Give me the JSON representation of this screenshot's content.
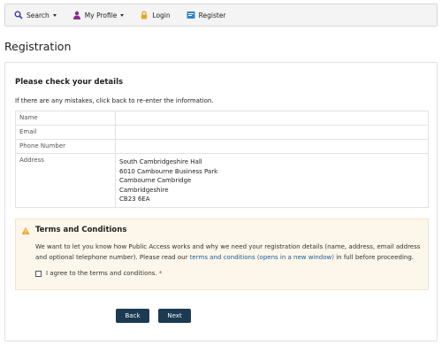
{
  "nav": {
    "search_label": "Search",
    "profile_label": "My Profile",
    "login_label": "Login",
    "register_label": "Register"
  },
  "page": {
    "title": "Registration"
  },
  "details": {
    "heading": "Please check your details",
    "intro": "If there are any mistakes, click back to re-enter the information.",
    "rows": [
      {
        "label": "Name",
        "value": ""
      },
      {
        "label": "Email",
        "value": ""
      },
      {
        "label": "Phone Number",
        "value": ""
      },
      {
        "label": "Address",
        "lines": [
          "South Cambridgeshire Hall",
          "6010 Cambourne Business Park",
          "Cambourne Cambridge",
          "Cambridgeshire",
          "CB23 6EA"
        ]
      }
    ]
  },
  "terms": {
    "title": "Terms and Conditions",
    "body_part1": "We want to let you know how Public Access works and why we need your registration details (name, address, email address and optional telephone number). Please read our ",
    "link_text": "terms and conditions (opens in a new window)",
    "body_part2": " in full before proceeding.",
    "agree_label": "I agree to the terms and conditions.",
    "required_marker": "*"
  },
  "buttons": {
    "back": "Back",
    "next": "Next"
  },
  "colors": {
    "button_bg": "#1c3a52",
    "terms_bg": "#fcf7ea",
    "link": "#1d5a9c",
    "warning": "#f0a52a"
  }
}
